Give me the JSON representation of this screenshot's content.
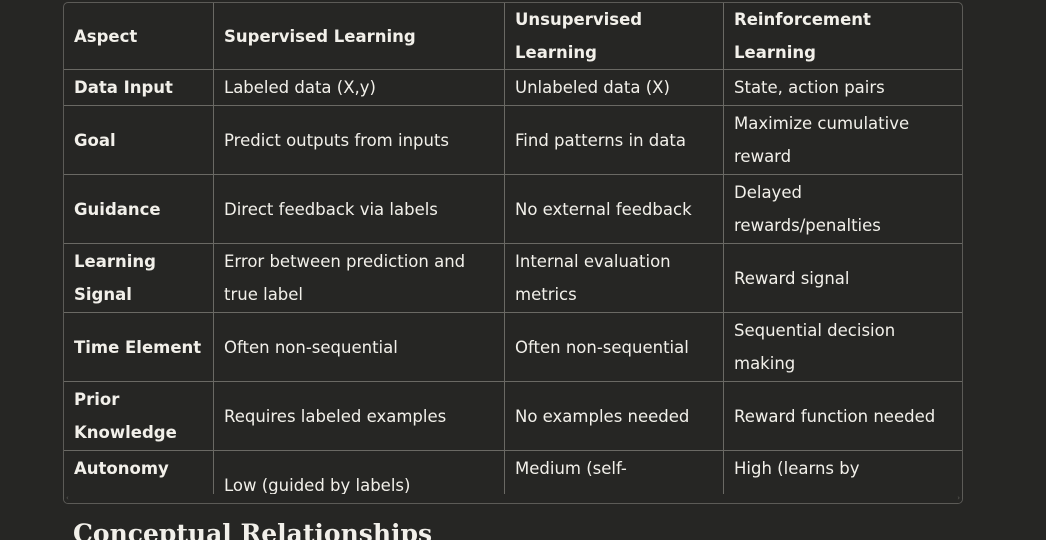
{
  "table": {
    "headers": [
      "Aspect",
      "Supervised Learning",
      "Unsupervised Learning",
      "Reinforcement Learning"
    ],
    "rows": [
      [
        "Data Input",
        "Labeled data (X,y)",
        "Unlabeled data (X)",
        "State, action pairs"
      ],
      [
        "Goal",
        "Predict outputs from inputs",
        "Find patterns in data",
        "Maximize cumulative reward"
      ],
      [
        "Guidance",
        "Direct feedback via labels",
        "No external feedback",
        "Delayed rewards/penalties"
      ],
      [
        "Learning Signal",
        "Error between prediction and true label",
        "Internal evaluation metrics",
        "Reward signal"
      ],
      [
        "Time Element",
        "Often non-sequential",
        "Often non-sequential",
        "Sequential decision making"
      ],
      [
        "Prior Knowledge",
        "Requires labeled examples",
        "No examples needed",
        "Reward function needed"
      ],
      [
        "Autonomy Level",
        "Low (guided by labels)",
        "Medium (self-organizing)",
        "High (learns by experience)"
      ]
    ]
  },
  "scrollbar": {
    "left_icon": "‹",
    "right_icon": "›"
  },
  "section_heading": "Conceptual Relationships"
}
